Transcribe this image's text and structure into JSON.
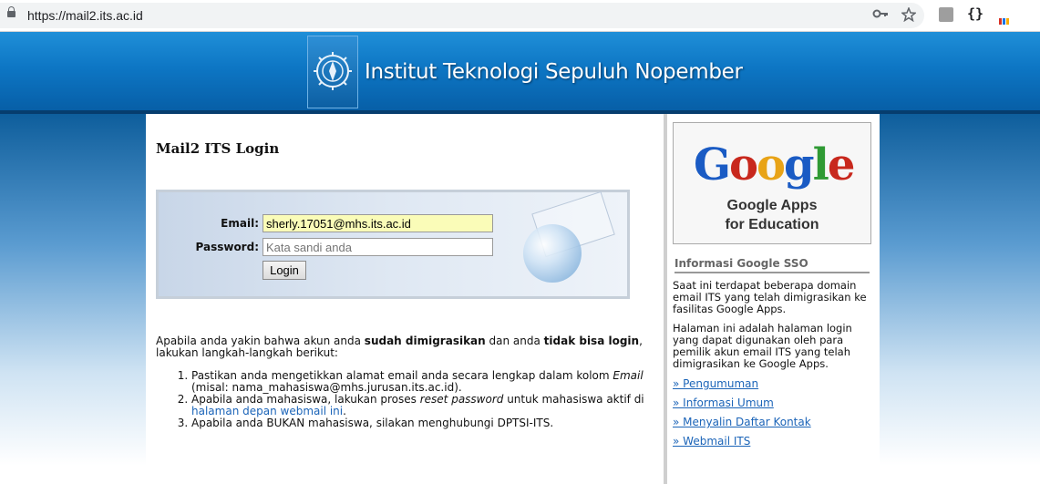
{
  "browser": {
    "url": "https://mail2.its.ac.id",
    "icons": [
      "lock-icon",
      "key-icon",
      "star-icon",
      "extension-icon",
      "braces-icon",
      "bars-icon"
    ]
  },
  "header": {
    "title": "Institut Teknologi Sepuluh Nopember",
    "color": "#0d76c4"
  },
  "main": {
    "title": "Mail2 ITS Login",
    "email_label": "Email:",
    "email_value": "sherly.17051@mhs.its.ac.id",
    "password_label": "Password:",
    "password_placeholder": "Kata sandi anda",
    "login_button": "Login",
    "intro_1": "Apabila anda yakin bahwa akun anda ",
    "intro_bold_1": "sudah dimigrasikan",
    "intro_2": " dan anda ",
    "intro_bold_2": "tidak bisa login",
    "intro_3": ", lakukan langkah-langkah berikut:",
    "step1_a": "Pastikan anda mengetikkan alamat email anda secara lengkap dalam kolom ",
    "step1_em": "Email",
    "step1_b": " (misal: nama_mahasiswa@mhs.jurusan.its.ac.id).",
    "step2_a": "Apabila anda mahasiswa, lakukan proses ",
    "step2_em": "reset password",
    "step2_b": " untuk mahasiswa aktif di ",
    "step2_link": "halaman depan webmail ini",
    "step2_c": ".",
    "step3": "Apabila anda BUKAN mahasiswa, silakan menghubungi DPTSI-ITS."
  },
  "sidebar": {
    "google_logo": "Google",
    "google_apps_line1": "Google Apps",
    "google_apps_line2": "for Education",
    "sso_title": "Informasi Google SSO",
    "para1": "Saat ini terdapat beberapa domain email ITS yang telah dimigrasikan ke fasilitas Google Apps.",
    "para2": "Halaman ini adalah halaman login yang dapat digunakan oleh para pemilik akun email ITS yang telah dimigrasikan ke Google Apps.",
    "links": [
      "» Pengumuman",
      "» Informasi Umum",
      "» Menyalin Daftar Kontak",
      "» Webmail ITS"
    ]
  }
}
